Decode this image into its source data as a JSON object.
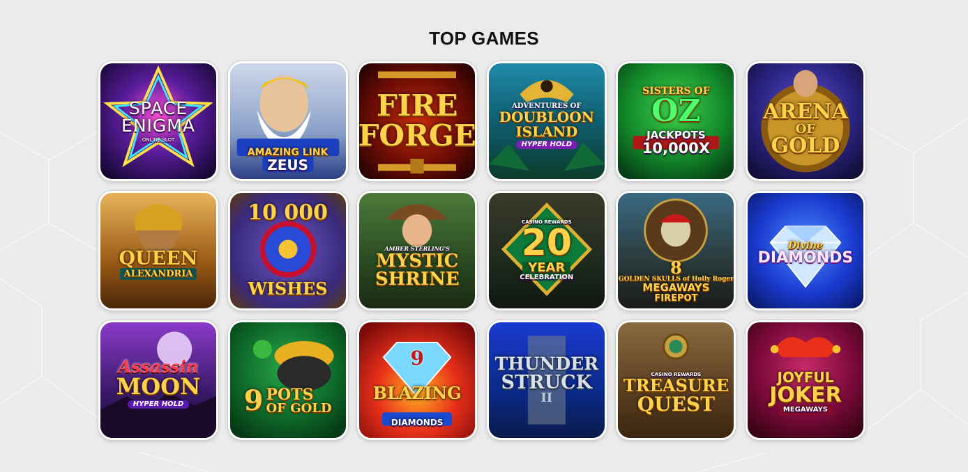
{
  "page": {
    "title": "TOP GAMES"
  },
  "games": [
    {
      "lines": [
        "SPACE",
        "ENIGMA",
        "ONLINE SLOT"
      ]
    },
    {
      "lines": [
        "AMAZING LINK",
        "ZEUS"
      ]
    },
    {
      "lines": [
        "FIRE",
        "FORGE"
      ]
    },
    {
      "lines": [
        "ADVENTURES OF",
        "DOUBLOON",
        "ISLAND",
        "HYPER HOLD"
      ]
    },
    {
      "lines": [
        "SISTERS OF",
        "OZ",
        "JACKPOTS",
        "10,000X"
      ]
    },
    {
      "lines": [
        "ARENA",
        "OF",
        "GOLD"
      ]
    },
    {
      "lines": [
        "QUEEN",
        "ALEXANDRIA"
      ]
    },
    {
      "lines": [
        "10 000",
        "WISHES"
      ]
    },
    {
      "lines": [
        "AMBER STERLING'S",
        "MYSTIC",
        "SHRINE"
      ]
    },
    {
      "lines": [
        "CASINO REWARDS",
        "20",
        "YEAR",
        "CELEBRATION"
      ]
    },
    {
      "lines": [
        "8",
        "GOLDEN SKULLS of Holly Roger",
        "MEGAWAYS",
        "FIREPOT"
      ]
    },
    {
      "lines": [
        "Divine",
        "DIAMONDS"
      ]
    },
    {
      "lines": [
        "Assassin",
        "MOON",
        "HYPER HOLD"
      ]
    },
    {
      "lines": [
        "9",
        "POTS",
        "OF GOLD"
      ]
    },
    {
      "lines": [
        "9",
        "BLAZING",
        "DIAMONDS"
      ]
    },
    {
      "lines": [
        "THUNDER",
        "STRUCK",
        "II"
      ]
    },
    {
      "lines": [
        "CASINO REWARDS",
        "TREASURE",
        "QUEST"
      ]
    },
    {
      "lines": [
        "JOYFUL",
        "JOKER",
        "MEGAWAYS"
      ]
    }
  ],
  "colors": {
    "background": "#ebebeb",
    "title": "#111111",
    "tile_border": "#ffffff"
  }
}
